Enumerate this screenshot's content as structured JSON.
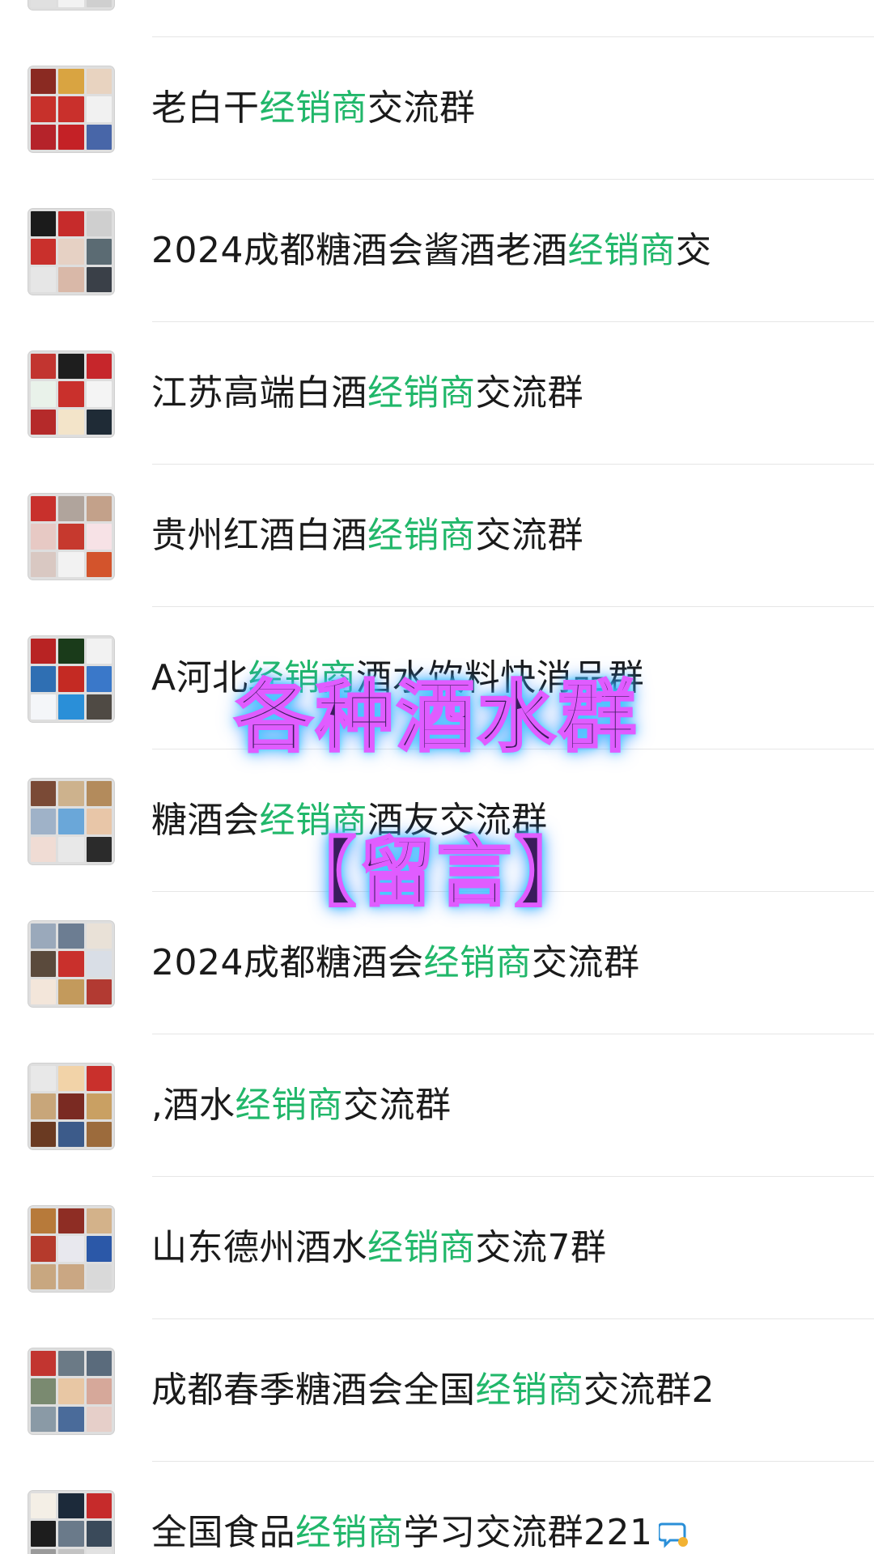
{
  "highlight_color": "#21b76a",
  "groups": [
    {
      "prefix": "",
      "keyword": "",
      "suffix": "",
      "avatar": [
        "#c9302c",
        "#2b2b2b",
        "#8a1c1c",
        "#b8b8b8",
        "#d9d9d9",
        "#c7c7c7",
        "#e0e0e0",
        "#f2f2f2",
        "#cfcfcf"
      ]
    },
    {
      "prefix": "老白干",
      "keyword": "经销商",
      "suffix": "交流群",
      "avatar": [
        "#8a2a22",
        "#d9a441",
        "#e8d3c0",
        "#c7312b",
        "#c9302c",
        "#f1f1f1",
        "#b5232a",
        "#c42126",
        "#4866a8"
      ]
    },
    {
      "prefix": "2024成都糖酒会酱酒老酒",
      "keyword": "经销商",
      "suffix": "交",
      "avatar": [
        "#1b1b1b",
        "#c62b2b",
        "#cfcfcf",
        "#c9302c",
        "#e6d1c4",
        "#5b6b73",
        "#e6e6e6",
        "#d9b8a8",
        "#3a4048"
      ]
    },
    {
      "prefix": "江苏高端白酒",
      "keyword": "经销商",
      "suffix": "交流群",
      "avatar": [
        "#c23530",
        "#1e1e1e",
        "#c6262b",
        "#e9f2ea",
        "#c9302c",
        "#f4f4f4",
        "#b52a2a",
        "#f3e4c9",
        "#1f2b36"
      ]
    },
    {
      "prefix": "贵州红酒白酒",
      "keyword": "经销商",
      "suffix": "交流群",
      "avatar": [
        "#c8302c",
        "#b0a49c",
        "#c3a18a",
        "#e7c9c4",
        "#c6392e",
        "#f7e2e6",
        "#d9c8c2",
        "#f2f2f2",
        "#d3542c"
      ]
    },
    {
      "prefix": "A河北",
      "keyword": "经销商",
      "suffix": "酒水饮料快消品群",
      "avatar": [
        "#b82323",
        "#1a3b1a",
        "#f2f2f2",
        "#2f6fb3",
        "#c42a23",
        "#3a78c9",
        "#f4f6f9",
        "#2a8fd8",
        "#4f4a44"
      ]
    },
    {
      "prefix": "糖酒会",
      "keyword": "经销商",
      "suffix": "酒友交流群",
      "avatar": [
        "#7a4a36",
        "#cdb28d",
        "#b38b5c",
        "#9fb2c8",
        "#6aa7d9",
        "#e8c6a8",
        "#f0dcd4",
        "#e8e8e8",
        "#2b2b2b"
      ]
    },
    {
      "prefix": "2024成都糖酒会",
      "keyword": "经销商",
      "suffix": "交流群",
      "avatar": [
        "#9aa9bb",
        "#6c7d92",
        "#e9e1d7",
        "#5a4a3c",
        "#c9302c",
        "#d9dee6",
        "#f3e6da",
        "#c39a5c",
        "#b23a32"
      ]
    },
    {
      "prefix": ",酒水",
      "keyword": "经销商",
      "suffix": "交流群",
      "avatar": [
        "#e8e8e8",
        "#f2d3a8",
        "#c9302c",
        "#c8a67a",
        "#7a2a22",
        "#c9a063",
        "#6a3a22",
        "#3c5b8a",
        "#9c6b3c"
      ]
    },
    {
      "prefix": "山东德州酒水",
      "keyword": "经销商",
      "suffix": "交流7群",
      "avatar": [
        "#b77a3a",
        "#8e2d24",
        "#d3b28a",
        "#b53a2c",
        "#e8e8ee",
        "#2b58a8",
        "#c8a780",
        "#caa783",
        "#d9d9d9"
      ]
    },
    {
      "prefix": "成都春季糖酒会全国",
      "keyword": "经销商",
      "suffix": "交流群2",
      "avatar": [
        "#c23530",
        "#6b7a86",
        "#5a6b7c",
        "#7a8a70",
        "#e8c7a4",
        "#d6a89a",
        "#8a9aa6",
        "#4a6b9a",
        "#e6cfc9"
      ]
    },
    {
      "prefix": "全国食品",
      "keyword": "经销商",
      "suffix": "学习交流群221",
      "avatar": [
        "#f4efe6",
        "#1c2a3a",
        "#c62b2b",
        "#1d1d1d",
        "#6a7a8a",
        "#3a4a5a",
        "#9a9a9a",
        "#c3c3c3",
        "#e2e2e2"
      ],
      "has_icon": true
    }
  ],
  "overlay": {
    "line1": "各种酒水群",
    "line2": "【留言】"
  },
  "icons": {
    "chat": "chat-bubble-icon"
  }
}
